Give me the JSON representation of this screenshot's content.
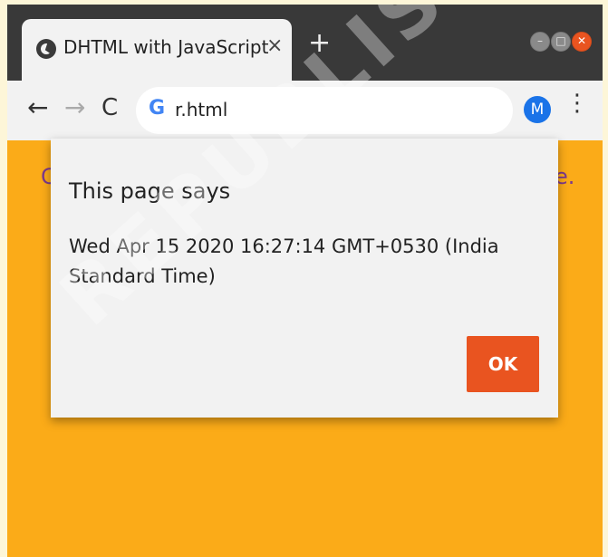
{
  "browser": {
    "tab": {
      "title": "DHTML with JavaScript",
      "close_glyph": "×",
      "icon": "globe-icon"
    },
    "new_tab_glyph": "+",
    "window_controls": [
      "minimize",
      "maximize",
      "close"
    ],
    "toolbar": {
      "back_glyph": "←",
      "forward_glyph": "→",
      "reload_glyph": "C",
      "search_engine_glyph": "G",
      "url": "r.html",
      "profile_initial": "M",
      "menu_glyph": "⋮"
    }
  },
  "page": {
    "background_color": "#fbab18",
    "text_left": "C",
    "text_right": "e."
  },
  "dialog": {
    "title": "This page says",
    "message": "Wed Apr 15 2020 16:27:14 GMT+0530 (India Standard Time)",
    "ok_label": "OK",
    "ok_color": "#e95420"
  },
  "watermark": {
    "text": "REPUBLISHED"
  }
}
